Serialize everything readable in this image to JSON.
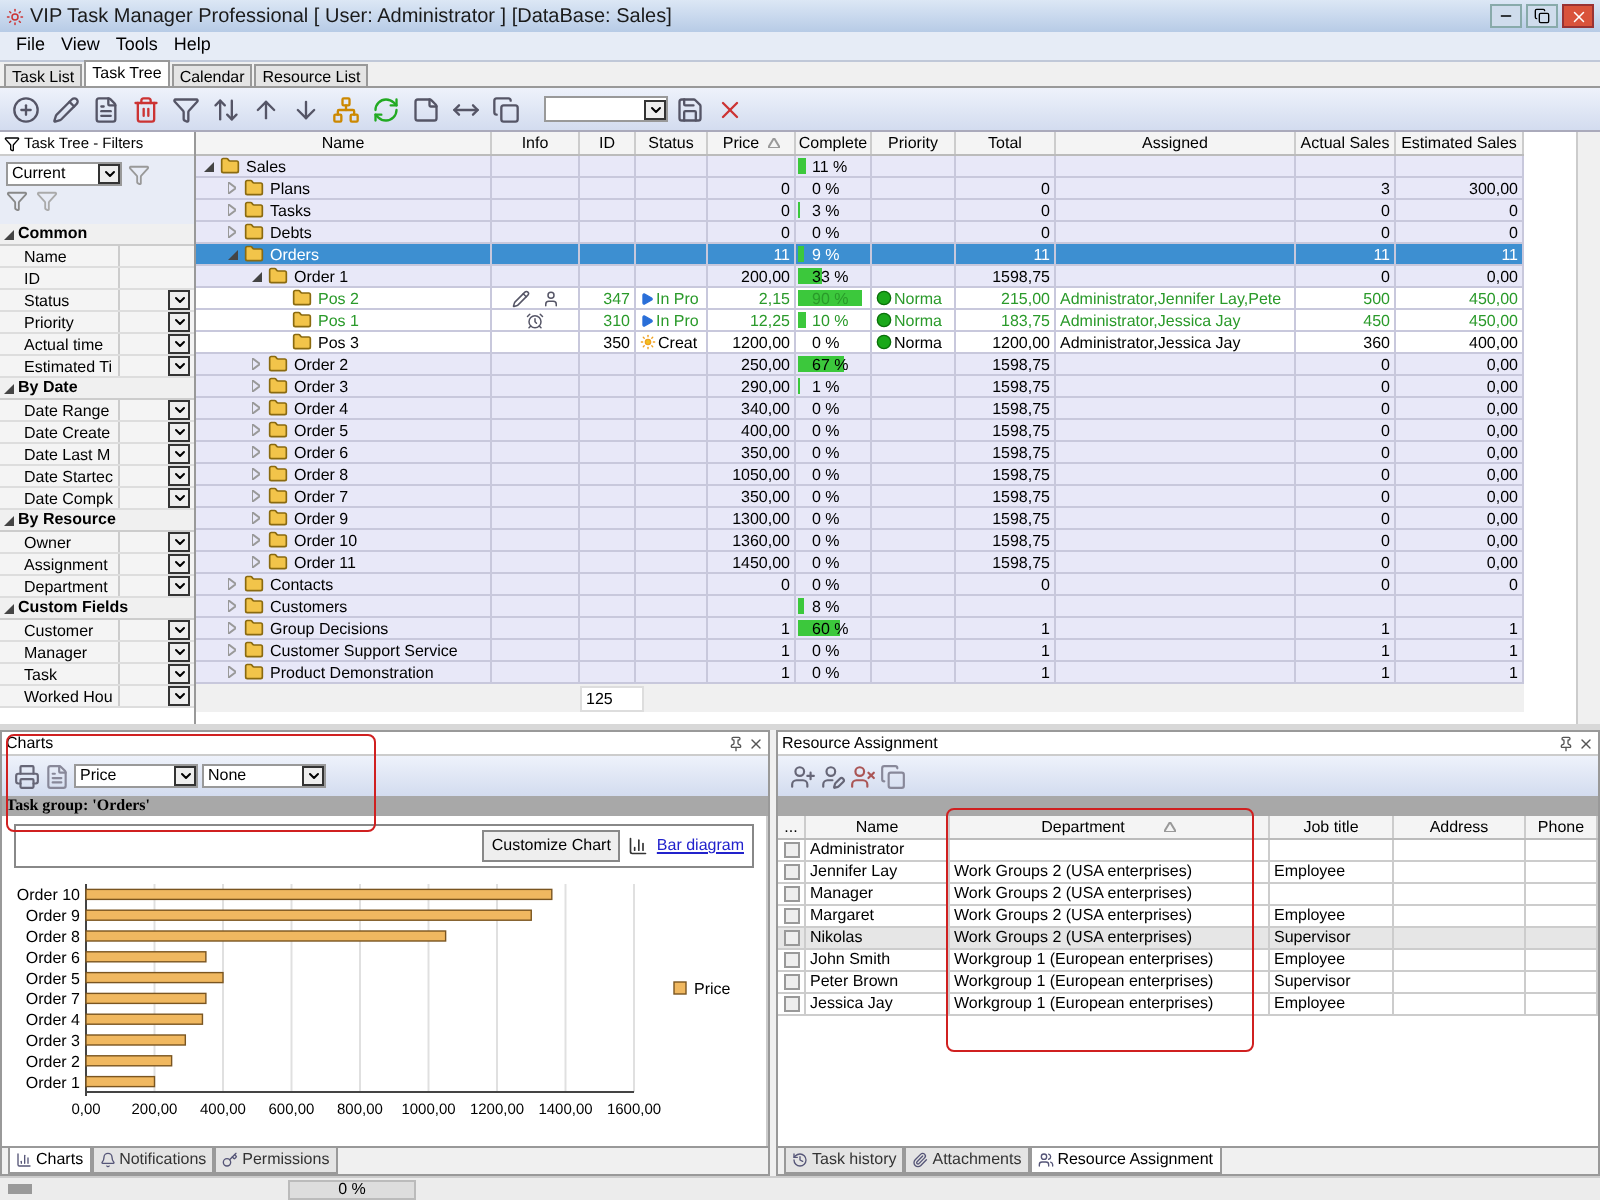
{
  "window": {
    "title": "VIP Task Manager Professional [ User: Administrator ] [DataBase: Sales]"
  },
  "menu": [
    "File",
    "View",
    "Tools",
    "Help"
  ],
  "tabs": [
    {
      "label": "Task List",
      "selected": false
    },
    {
      "label": "Task Tree",
      "selected": true
    },
    {
      "label": "Calendar",
      "selected": false
    },
    {
      "label": "Resource List",
      "selected": false
    }
  ],
  "filters": {
    "title": "Task Tree - Filters",
    "preset": "Current",
    "sections": [
      {
        "title": "Common",
        "expanded": true,
        "items": [
          {
            "label": "Name",
            "kind": "text"
          },
          {
            "label": "ID",
            "kind": "text"
          },
          {
            "label": "Status",
            "kind": "select"
          },
          {
            "label": "Priority",
            "kind": "select"
          },
          {
            "label": "Actual time",
            "kind": "select"
          },
          {
            "label": "Estimated Ti",
            "kind": "select"
          }
        ]
      },
      {
        "title": "By Date",
        "expanded": true,
        "items": [
          {
            "label": "Date Range",
            "kind": "select"
          },
          {
            "label": "Date Create",
            "kind": "select"
          },
          {
            "label": "Date Last M",
            "kind": "select"
          },
          {
            "label": "Date Startec",
            "kind": "select"
          },
          {
            "label": "Date Compk",
            "kind": "select"
          }
        ]
      },
      {
        "title": "By Resource",
        "expanded": true,
        "items": [
          {
            "label": "Owner",
            "kind": "select"
          },
          {
            "label": "Assignment",
            "kind": "select"
          },
          {
            "label": "Department",
            "kind": "select"
          }
        ]
      },
      {
        "title": "Custom Fields",
        "expanded": true,
        "items": [
          {
            "label": "Customer",
            "kind": "select"
          },
          {
            "label": "Manager",
            "kind": "select"
          },
          {
            "label": "Task",
            "kind": "select"
          },
          {
            "label": "Worked Hou",
            "kind": "select"
          }
        ]
      }
    ]
  },
  "tree": {
    "columns": [
      {
        "label": "Name",
        "sorted": false
      },
      {
        "label": "Info",
        "sorted": false
      },
      {
        "label": "ID",
        "sorted": false
      },
      {
        "label": "Status",
        "sorted": false
      },
      {
        "label": "Price",
        "sorted": true
      },
      {
        "label": "Complete",
        "sorted": false
      },
      {
        "label": "Priority",
        "sorted": false
      },
      {
        "label": "Total",
        "sorted": false
      },
      {
        "label": "Assigned",
        "sorted": false
      },
      {
        "label": "Actual Sales",
        "sorted": false
      },
      {
        "label": "Estimated Sales",
        "sorted": false
      }
    ],
    "footer_id": "125",
    "rows": [
      {
        "name": "Sales",
        "expanded": true,
        "selected": false,
        "complete": "11 %",
        "level": 0.11,
        "children": [
          {
            "name": "Plans",
            "expanded": false,
            "selected": false,
            "price": "0",
            "complete": "0 %",
            "total": "0",
            "actual_sales": "3",
            "estimated_sales": "300,00"
          },
          {
            "name": "Tasks",
            "expanded": false,
            "selected": false,
            "price": "0",
            "complete": "3 %",
            "level": 0.03,
            "total": "0",
            "actual_sales": "0",
            "estimated_sales": "0"
          },
          {
            "name": "Debts",
            "expanded": false,
            "selected": false,
            "price": "0",
            "complete": "0 %",
            "total": "0",
            "actual_sales": "0",
            "estimated_sales": "0"
          },
          {
            "name": "Orders",
            "expanded": true,
            "selected": true,
            "price": "11",
            "complete": "9 %",
            "level": 0.09,
            "total": "11",
            "actual_sales": "11",
            "estimated_sales": "11",
            "children": [
              {
                "name": "Order 1",
                "expanded": true,
                "selected": false,
                "price": "200,00",
                "complete": "33 %",
                "level": 0.33,
                "total": "1598,75",
                "actual_sales": "0",
                "estimated_sales": "0,00",
                "children": [
                  {
                    "name": "Pos 2",
                    "selected": false,
                    "info": [
                      {
                        "kind": "note"
                      },
                      {
                        "kind": "user"
                      }
                    ],
                    "id": "347",
                    "status": {
                      "text": "In Pro",
                      "kind": "in_progress"
                    },
                    "price": "2,15",
                    "complete": "90 %",
                    "level": 0.9,
                    "priority": "Norma",
                    "total": "215,00",
                    "assigned": "Administrator,Jennifer Lay,Pete",
                    "actual_sales": "500",
                    "estimated_sales": "450,00"
                  },
                  {
                    "name": "Pos 1",
                    "selected": false,
                    "info": [
                      {
                        "kind": "alarm"
                      }
                    ],
                    "id": "310",
                    "status": {
                      "text": "In Pro",
                      "kind": "in_progress"
                    },
                    "price": "12,25",
                    "complete": "10 %",
                    "level": 0.1,
                    "priority": "Norma",
                    "total": "183,75",
                    "assigned": "Administrator,Jessica Jay",
                    "actual_sales": "450",
                    "estimated_sales": "450,00"
                  },
                  {
                    "name": "Pos 3",
                    "selected": false,
                    "id": "350",
                    "status": {
                      "text": "Creat",
                      "kind": "created"
                    },
                    "price": "1200,00",
                    "complete": "0 %",
                    "priority": "Norma",
                    "total": "1200,00",
                    "assigned": "Administrator,Jessica Jay",
                    "actual_sales": "360",
                    "estimated_sales": "400,00"
                  }
                ]
              },
              {
                "name": "Order 2",
                "expanded": false,
                "selected": false,
                "price": "250,00",
                "complete": "67 %",
                "level": 0.67,
                "total": "1598,75",
                "actual_sales": "0",
                "estimated_sales": "0,00"
              },
              {
                "name": "Order 3",
                "expanded": false,
                "selected": false,
                "price": "290,00",
                "complete": "1 %",
                "level": 0.01,
                "total": "1598,75",
                "actual_sales": "0",
                "estimated_sales": "0,00"
              },
              {
                "name": "Order 4",
                "expanded": false,
                "selected": false,
                "price": "340,00",
                "complete": "0 %",
                "total": "1598,75",
                "actual_sales": "0",
                "estimated_sales": "0,00"
              },
              {
                "name": "Order 5",
                "expanded": false,
                "selected": false,
                "price": "400,00",
                "complete": "0 %",
                "total": "1598,75",
                "actual_sales": "0",
                "estimated_sales": "0,00"
              },
              {
                "name": "Order 6",
                "expanded": false,
                "selected": false,
                "price": "350,00",
                "complete": "0 %",
                "total": "1598,75",
                "actual_sales": "0",
                "estimated_sales": "0,00"
              },
              {
                "name": "Order 8",
                "expanded": false,
                "selected": false,
                "price": "1050,00",
                "complete": "0 %",
                "total": "1598,75",
                "actual_sales": "0",
                "estimated_sales": "0,00"
              },
              {
                "name": "Order 7",
                "expanded": false,
                "selected": false,
                "price": "350,00",
                "complete": "0 %",
                "total": "1598,75",
                "actual_sales": "0",
                "estimated_sales": "0,00"
              },
              {
                "name": "Order 9",
                "expanded": false,
                "selected": false,
                "price": "1300,00",
                "complete": "0 %",
                "total": "1598,75",
                "actual_sales": "0",
                "estimated_sales": "0,00"
              },
              {
                "name": "Order 10",
                "expanded": false,
                "selected": false,
                "price": "1360,00",
                "complete": "0 %",
                "total": "1598,75",
                "actual_sales": "0",
                "estimated_sales": "0,00"
              },
              {
                "name": "Order 11",
                "expanded": false,
                "selected": false,
                "price": "1450,00",
                "complete": "0 %",
                "total": "1598,75",
                "actual_sales": "0",
                "estimated_sales": "0,00"
              }
            ]
          },
          {
            "name": "Contacts",
            "expanded": false,
            "selected": false,
            "price": "0",
            "complete": "0 %",
            "total": "0",
            "actual_sales": "0",
            "estimated_sales": "0"
          },
          {
            "name": "Customers",
            "expanded": false,
            "selected": false,
            "complete": "8 %",
            "level": 0.08
          },
          {
            "name": "Group Decisions",
            "expanded": false,
            "selected": false,
            "price": "1",
            "complete": "60 %",
            "level": 0.6,
            "total": "1",
            "actual_sales": "1",
            "estimated_sales": "1"
          },
          {
            "name": "Customer Support Service",
            "expanded": false,
            "selected": false,
            "price": "1",
            "complete": "0 %",
            "total": "1",
            "actual_sales": "1",
            "estimated_sales": "1"
          },
          {
            "name": "Product Demonstration",
            "expanded": false,
            "selected": false,
            "price": "1",
            "complete": "0 %",
            "total": "1",
            "actual_sales": "1",
            "estimated_sales": "1"
          }
        ]
      }
    ]
  },
  "charts_panel": {
    "title": "Charts",
    "value_field": "Price",
    "series_field": "None",
    "group_title": "Task group: 'Orders'",
    "customize_button": "Customize Chart",
    "chart_type_link": "Bar diagram",
    "chart_data": {
      "type": "bar",
      "orientation": "horizontal",
      "grid": true,
      "categories": [
        "Order 10",
        "Order 9",
        "Order 8",
        "Order 6",
        "Order 5",
        "Order 7",
        "Order 4",
        "Order 3",
        "Order 2",
        "Order 1"
      ],
      "series": [
        {
          "name": "Price",
          "color": "#f0b860",
          "values": [
            1360,
            1300,
            1050,
            350,
            400,
            350,
            340,
            290,
            250,
            200
          ]
        }
      ],
      "xlim": [
        0,
        1600
      ],
      "xticks": [
        {
          "value": 0,
          "label": "0,00"
        },
        {
          "value": 200,
          "label": "200,00"
        },
        {
          "value": 400,
          "label": "400,00"
        },
        {
          "value": 600,
          "label": "600,00"
        },
        {
          "value": 800,
          "label": "800,00"
        },
        {
          "value": 1000,
          "label": "1000,00"
        },
        {
          "value": 1200,
          "label": "1200,00"
        },
        {
          "value": 1400,
          "label": "1400,00"
        },
        {
          "value": 1600,
          "label": "1600,00"
        }
      ]
    },
    "tabs": [
      {
        "label": "Charts",
        "selected": true
      },
      {
        "label": "Notifications",
        "selected": false
      },
      {
        "label": "Permissions",
        "selected": false
      }
    ]
  },
  "resource_panel": {
    "title": "Resource Assignment",
    "columns": [
      {
        "label": "...",
        "sorted": false
      },
      {
        "label": "Name",
        "sorted": false
      },
      {
        "label": "Department",
        "sorted": true
      },
      {
        "label": "Job title",
        "sorted": false
      },
      {
        "label": "Address",
        "sorted": false
      },
      {
        "label": "Phone",
        "sorted": false
      }
    ],
    "rows": [
      {
        "checked": false,
        "selected": false,
        "name": "Administrator"
      },
      {
        "checked": false,
        "selected": false,
        "name": "Jennifer Lay",
        "department": "Work Groups 2 (USA enterprises)",
        "job_title": "Employee"
      },
      {
        "checked": false,
        "selected": false,
        "name": "Manager",
        "department": "Work Groups 2 (USA enterprises)"
      },
      {
        "checked": false,
        "selected": false,
        "name": "Margaret",
        "department": "Work Groups 2 (USA enterprises)",
        "job_title": "Employee"
      },
      {
        "checked": false,
        "selected": true,
        "name": "Nikolas",
        "department": "Work Groups 2 (USA enterprises)",
        "job_title": "Supervisor"
      },
      {
        "checked": false,
        "selected": false,
        "name": "John Smith",
        "department": "Workgroup 1 (European enterprises)",
        "job_title": "Employee"
      },
      {
        "checked": false,
        "selected": false,
        "name": "Peter Brown",
        "department": "Workgroup 1 (European enterprises)",
        "job_title": "Supervisor"
      },
      {
        "checked": false,
        "selected": false,
        "name": "Jessica Jay",
        "department": "Workgroup 1 (European enterprises)",
        "job_title": "Employee"
      }
    ],
    "tabs": [
      {
        "label": "Task history",
        "selected": false
      },
      {
        "label": "Attachments",
        "selected": false
      },
      {
        "label": "Resource Assignment",
        "selected": true
      }
    ]
  },
  "status_bar": {
    "progress_text": "0 %"
  }
}
